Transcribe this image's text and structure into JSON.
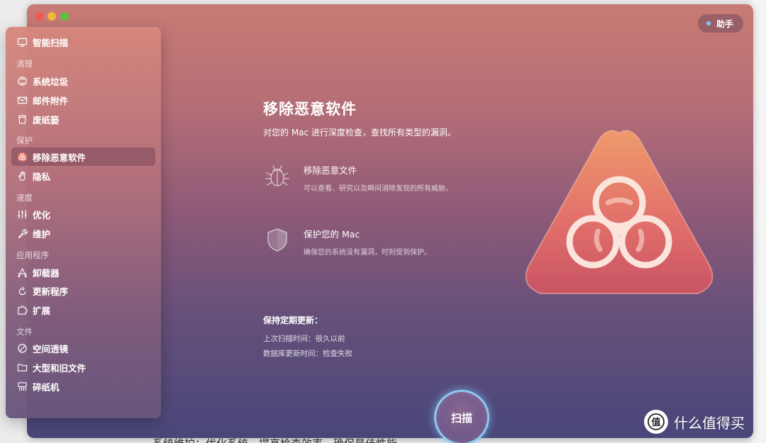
{
  "background": {
    "article_text": "系统维护：优化系统，提高检查效率，确保最佳性能。"
  },
  "window": {
    "assistant_label": "助手",
    "scan_label": "扫描"
  },
  "sidebar": {
    "top_item": {
      "label": "智能扫描",
      "icon": "monitor-icon"
    },
    "sections": [
      {
        "title": "清理"
      },
      {
        "title": "保护"
      },
      {
        "title": "速度"
      },
      {
        "title": "应用程序"
      },
      {
        "title": "文件"
      }
    ],
    "items": [
      {
        "label": "系统垃圾",
        "icon": "system-junk-icon"
      },
      {
        "label": "邮件附件",
        "icon": "mail-icon"
      },
      {
        "label": "废纸篓",
        "icon": "trash-icon"
      },
      {
        "label": "移除恶意软件",
        "icon": "biohazard-icon",
        "active": true
      },
      {
        "label": "隐私",
        "icon": "hand-icon"
      },
      {
        "label": "优化",
        "icon": "sliders-icon"
      },
      {
        "label": "维护",
        "icon": "wrench-icon"
      },
      {
        "label": "卸载器",
        "icon": "uninstaller-icon"
      },
      {
        "label": "更新程序",
        "icon": "updater-icon"
      },
      {
        "label": "扩展",
        "icon": "extensions-icon"
      },
      {
        "label": "空间透镜",
        "icon": "space-lens-icon"
      },
      {
        "label": "大型和旧文件",
        "icon": "folder-icon"
      },
      {
        "label": "碎纸机",
        "icon": "shredder-icon"
      }
    ]
  },
  "main": {
    "title": "移除恶意软件",
    "subtitle": "对您的 Mac 进行深度检查，查找所有类型的漏洞。",
    "features": [
      {
        "title": "移除恶意文件",
        "desc": "可以查看、研究以及瞬间消除发现的所有威胁。",
        "icon": "bug-icon"
      },
      {
        "title": "保护您的 Mac",
        "desc": "确保您的系统没有漏洞，时刻受到保护。",
        "icon": "shield-icon"
      }
    ],
    "maintenance": {
      "title": "保持定期更新：",
      "last_scan": "上次扫描时间：很久以前",
      "db_update": "数据库更新时间：检查失败"
    }
  },
  "watermark": {
    "text": "什么值得买",
    "badge": "值"
  },
  "colors": {
    "accent_glow": "#7ec8ff",
    "hero_triangle": "#e2706a",
    "traffic_close": "#ee5b53",
    "traffic_min": "#f3b93d",
    "traffic_max": "#5dc142"
  }
}
